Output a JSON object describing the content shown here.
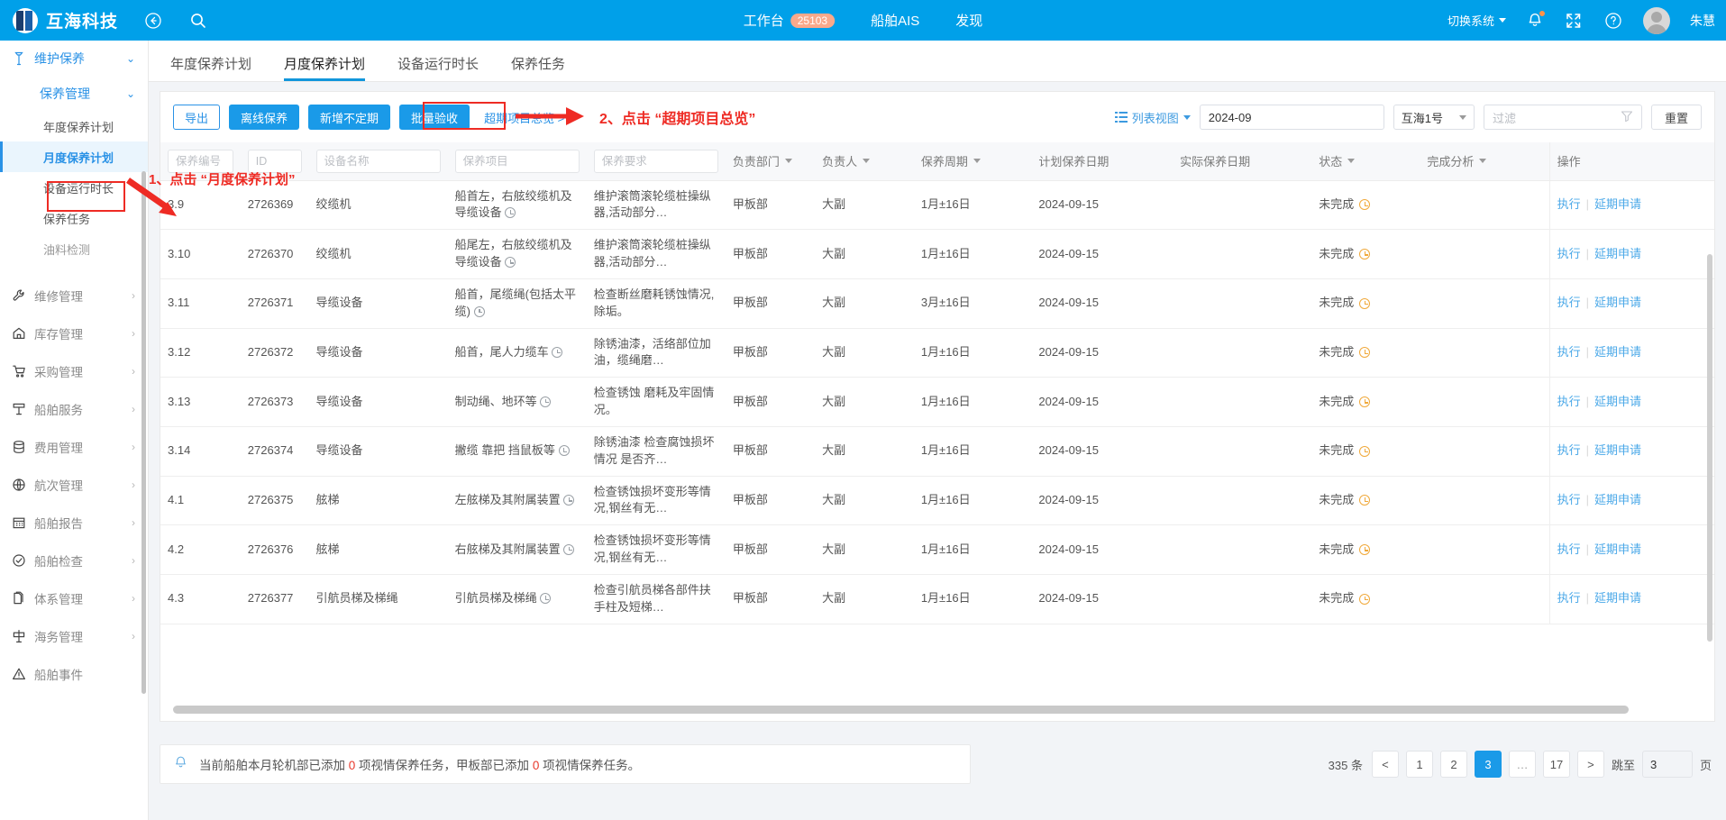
{
  "header": {
    "brand": "互海科技",
    "back_icon": "back-circle-icon",
    "search_icon": "search-icon",
    "nav": [
      {
        "label": "工作台",
        "badge": "25103"
      },
      {
        "label": "船舶AIS",
        "badge": ""
      },
      {
        "label": "发现",
        "badge": ""
      }
    ],
    "switch_system": "切换系统",
    "user_name": "朱慧"
  },
  "sidebar": {
    "top": {
      "label": "维护保养",
      "icon": "wrench-tool-icon"
    },
    "group": {
      "label": "保养管理"
    },
    "sub_items": [
      {
        "label": "年度保养计划",
        "active": false,
        "dim": false
      },
      {
        "label": "月度保养计划",
        "active": true,
        "dim": false
      },
      {
        "label": "设备运行时长",
        "active": false,
        "dim": false
      },
      {
        "label": "保养任务",
        "active": false,
        "dim": false
      },
      {
        "label": "油料检测",
        "active": false,
        "dim": true
      }
    ],
    "items": [
      {
        "label": "维修管理",
        "icon": "wrench-icon"
      },
      {
        "label": "库存管理",
        "icon": "home-icon"
      },
      {
        "label": "采购管理",
        "icon": "cart-icon"
      },
      {
        "label": "船舶服务",
        "icon": "service-icon"
      },
      {
        "label": "费用管理",
        "icon": "database-icon"
      },
      {
        "label": "航次管理",
        "icon": "globe-icon"
      },
      {
        "label": "船舶报告",
        "icon": "calendar-icon"
      },
      {
        "label": "船舶检查",
        "icon": "check-circle-icon"
      },
      {
        "label": "体系管理",
        "icon": "documents-icon"
      },
      {
        "label": "海务管理",
        "icon": "signpost-icon"
      },
      {
        "label": "船舶事件",
        "icon": "warning-triangle-icon"
      }
    ]
  },
  "annotations": [
    {
      "id": "step1",
      "text": "1、点击 “月度保养计划”",
      "color": "#ee2b24"
    },
    {
      "id": "step2",
      "text": "2、点击 “超期项目总览”",
      "color": "#ee2b24"
    }
  ],
  "tabs": [
    {
      "label": "年度保养计划",
      "active": false
    },
    {
      "label": "月度保养计划",
      "active": true
    },
    {
      "label": "设备运行时长",
      "active": false
    },
    {
      "label": "保养任务",
      "active": false
    }
  ],
  "toolbar": {
    "export": "导出",
    "offline": "离线保养",
    "add_irregular": "新增不定期",
    "batch_accept": "批量验收",
    "overdue_overview": "超期项目总览 >",
    "view_mode": "列表视图",
    "month_value": "2024-09",
    "ship_value": "互海1号",
    "filter_placeholder": "过滤",
    "reset": "重置"
  },
  "table": {
    "columns": [
      {
        "key": "code",
        "label": "保养编号",
        "type": "input"
      },
      {
        "key": "id",
        "label": "ID",
        "type": "input"
      },
      {
        "key": "equipment",
        "label": "设备名称",
        "type": "input"
      },
      {
        "key": "item",
        "label": "保养项目",
        "type": "input"
      },
      {
        "key": "requirement",
        "label": "保养要求",
        "type": "input"
      },
      {
        "key": "dept",
        "label": "负责部门",
        "type": "sort"
      },
      {
        "key": "owner",
        "label": "负责人",
        "type": "sort"
      },
      {
        "key": "cycle",
        "label": "保养周期",
        "type": "sort"
      },
      {
        "key": "plan_date",
        "label": "计划保养日期",
        "type": "plain"
      },
      {
        "key": "actual_date",
        "label": "实际保养日期",
        "type": "plain"
      },
      {
        "key": "status",
        "label": "状态",
        "type": "sort"
      },
      {
        "key": "analysis",
        "label": "完成分析",
        "type": "sort"
      },
      {
        "key": "ops",
        "label": "操作",
        "type": "plain"
      }
    ],
    "rows": [
      {
        "code": "3.9",
        "id": "2726369",
        "equipment": "绞缆机",
        "item": "船首左，右舷绞缆机及导缆设备",
        "requirement": "维护滚筒滚轮缆桩操纵器,活动部分…",
        "dept": "甲板部",
        "owner": "大副",
        "cycle": "1月±16日",
        "plan_date": "2024-09-15",
        "actual_date": "",
        "status": "未完成",
        "analysis": "",
        "op_exec": "执行",
        "op_delay": "延期申请"
      },
      {
        "code": "3.10",
        "id": "2726370",
        "equipment": "绞缆机",
        "item": "船尾左，右舷绞缆机及导缆设备",
        "requirement": "维护滚筒滚轮缆桩操纵器,活动部分…",
        "dept": "甲板部",
        "owner": "大副",
        "cycle": "1月±16日",
        "plan_date": "2024-09-15",
        "actual_date": "",
        "status": "未完成",
        "analysis": "",
        "op_exec": "执行",
        "op_delay": "延期申请"
      },
      {
        "code": "3.11",
        "id": "2726371",
        "equipment": "导缆设备",
        "item": "船首，尾缆绳(包括太平缆)",
        "requirement": "检查断丝磨耗锈蚀情况,除垢。",
        "dept": "甲板部",
        "owner": "大副",
        "cycle": "3月±16日",
        "plan_date": "2024-09-15",
        "actual_date": "",
        "status": "未完成",
        "analysis": "",
        "op_exec": "执行",
        "op_delay": "延期申请"
      },
      {
        "code": "3.12",
        "id": "2726372",
        "equipment": "导缆设备",
        "item": "船首，尾人力缆车",
        "requirement": "除锈油漆，活络部位加油，缆绳磨…",
        "dept": "甲板部",
        "owner": "大副",
        "cycle": "1月±16日",
        "plan_date": "2024-09-15",
        "actual_date": "",
        "status": "未完成",
        "analysis": "",
        "op_exec": "执行",
        "op_delay": "延期申请"
      },
      {
        "code": "3.13",
        "id": "2726373",
        "equipment": "导缆设备",
        "item": "制动绳、地环等",
        "requirement": "检查锈蚀 磨耗及牢固情况。",
        "dept": "甲板部",
        "owner": "大副",
        "cycle": "1月±16日",
        "plan_date": "2024-09-15",
        "actual_date": "",
        "status": "未完成",
        "analysis": "",
        "op_exec": "执行",
        "op_delay": "延期申请"
      },
      {
        "code": "3.14",
        "id": "2726374",
        "equipment": "导缆设备",
        "item": "撇缆 靠把 挡鼠板等",
        "requirement": "除锈油漆 检查腐蚀损坏情况 是否齐…",
        "dept": "甲板部",
        "owner": "大副",
        "cycle": "1月±16日",
        "plan_date": "2024-09-15",
        "actual_date": "",
        "status": "未完成",
        "analysis": "",
        "op_exec": "执行",
        "op_delay": "延期申请"
      },
      {
        "code": "4.1",
        "id": "2726375",
        "equipment": "舷梯",
        "item": "左舷梯及其附属装置",
        "requirement": "检查锈蚀损坏变形等情况,钢丝有无…",
        "dept": "甲板部",
        "owner": "大副",
        "cycle": "1月±16日",
        "plan_date": "2024-09-15",
        "actual_date": "",
        "status": "未完成",
        "analysis": "",
        "op_exec": "执行",
        "op_delay": "延期申请"
      },
      {
        "code": "4.2",
        "id": "2726376",
        "equipment": "舷梯",
        "item": "右舷梯及其附属装置",
        "requirement": "检查锈蚀损坏变形等情况,钢丝有无…",
        "dept": "甲板部",
        "owner": "大副",
        "cycle": "1月±16日",
        "plan_date": "2024-09-15",
        "actual_date": "",
        "status": "未完成",
        "analysis": "",
        "op_exec": "执行",
        "op_delay": "延期申请"
      },
      {
        "code": "4.3",
        "id": "2726377",
        "equipment": "引航员梯及梯绳",
        "item": "引航员梯及梯绳",
        "requirement": "检查引航员梯各部件扶手柱及短梯…",
        "dept": "甲板部",
        "owner": "大副",
        "cycle": "1月±16日",
        "plan_date": "2024-09-15",
        "actual_date": "",
        "status": "未完成",
        "analysis": "",
        "op_exec": "执行",
        "op_delay": "延期申请"
      }
    ]
  },
  "notice": {
    "icon": "bell-icon",
    "part1": "当前船舶本月轮机部已添加",
    "num1": "0",
    "part2": "项视情保养任务，甲板部已添加",
    "num2": "0",
    "part3": "项视情保养任务。"
  },
  "pagination": {
    "total": "335 条",
    "prev": "<",
    "pages": [
      "1",
      "2",
      "3",
      "…",
      "17"
    ],
    "active_page": "3",
    "next": ">",
    "jump_label": "跳至",
    "jump_value": "3",
    "page_unit": "页"
  },
  "colors": {
    "header_blue": "#00a0e9",
    "primary": "#1a9ae8",
    "link": "#4aa8e8",
    "accent_red": "#ee2b24",
    "badge_peach": "#f9a98b",
    "status_orange": "#f0a93b"
  }
}
